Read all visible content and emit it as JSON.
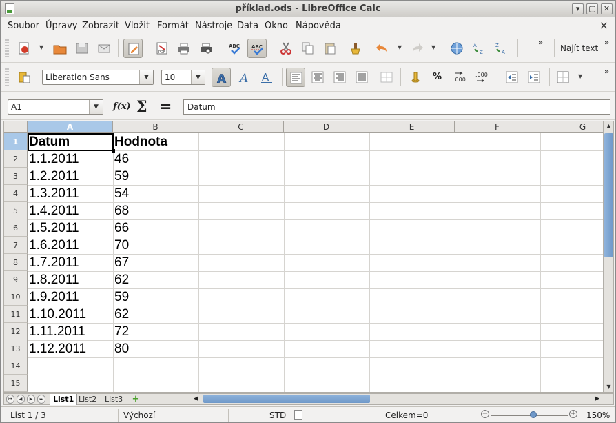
{
  "window": {
    "title": "příklad.ods - LibreOffice Calc",
    "minimize": "▾",
    "maximize": "▢",
    "close": "✕"
  },
  "menu": [
    {
      "id": "soubor",
      "label": "Soubor"
    },
    {
      "id": "upravy",
      "label": "Úpravy"
    },
    {
      "id": "zobrazit",
      "label": "Zobrazit"
    },
    {
      "id": "vlozit",
      "label": "Vložit"
    },
    {
      "id": "format",
      "label": "Formát"
    },
    {
      "id": "nastroje",
      "label": "Nástroje"
    },
    {
      "id": "data",
      "label": "Data"
    },
    {
      "id": "okno",
      "label": "Okno"
    },
    {
      "id": "napoveda",
      "label": "Nápověda"
    }
  ],
  "menu_close": "×",
  "toolbar": {
    "find_text": "Najít text",
    "more": "»"
  },
  "format": {
    "font_name": "Liberation Sans",
    "font_size": "10",
    "percent": "%",
    "dec_add": ".000",
    "dec_remove": ".000"
  },
  "formula": {
    "cell_ref": "A1",
    "fx": "f(x)",
    "sigma": "Σ",
    "equals": "=",
    "content": "Datum"
  },
  "columns": [
    "A",
    "B",
    "C",
    "D",
    "E",
    "F",
    "G"
  ],
  "rows": [
    "1",
    "2",
    "3",
    "4",
    "5",
    "6",
    "7",
    "8",
    "9",
    "10",
    "11",
    "12",
    "13",
    "14",
    "15"
  ],
  "cells": {
    "header": {
      "a": "Datum",
      "b": "Hodnota"
    },
    "data": [
      {
        "a": "1.1.2011",
        "b": "46"
      },
      {
        "a": "1.2.2011",
        "b": "59"
      },
      {
        "a": "1.3.2011",
        "b": "54"
      },
      {
        "a": "1.4.2011",
        "b": "68"
      },
      {
        "a": "1.5.2011",
        "b": "66"
      },
      {
        "a": "1.6.2011",
        "b": "70"
      },
      {
        "a": "1.7.2011",
        "b": "67"
      },
      {
        "a": "1.8.2011",
        "b": "62"
      },
      {
        "a": "1.9.2011",
        "b": "59"
      },
      {
        "a": "1.10.2011",
        "b": "62"
      },
      {
        "a": "1.11.2011",
        "b": "72"
      },
      {
        "a": "1.12.2011",
        "b": "80"
      }
    ]
  },
  "sheets": [
    "List1",
    "List2",
    "List3"
  ],
  "add_sheet": "+",
  "status": {
    "sheet": "List 1 / 3",
    "style": "Výchozí",
    "mode": "STD",
    "sum": "Celkem=0",
    "zoom_minus": "−",
    "zoom_plus": "+",
    "zoom": "150%"
  },
  "colors": {
    "selection": "#a9c8e8",
    "scroll_thumb": "#6f98c8"
  }
}
